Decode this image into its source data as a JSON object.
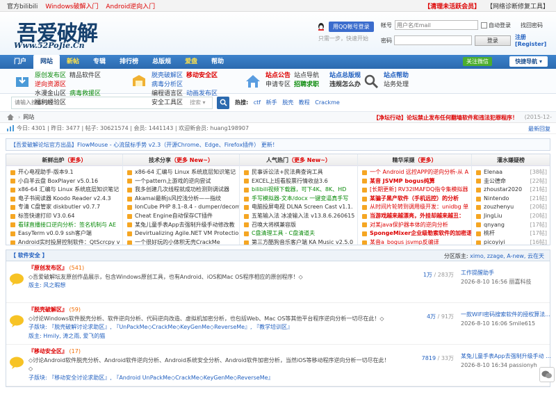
{
  "topbar": {
    "site_name": "官方bilibili",
    "link1": "Windows破解入门",
    "link2": "Android逆向入门",
    "right1": "【清理未活跃会员】",
    "right2": "【网络诊断修复工具】"
  },
  "header": {
    "logo_text": "吾爱破解",
    "logo_url": "Www.52PoJie.Cn",
    "qq_login": "用QQ帐号登录",
    "qq_tip": "只需一步，快速开始",
    "account_label": "帐号",
    "account_placeholder": "用户名/Email",
    "autologin": "自动登录",
    "find_pw": "找回密码",
    "password_label": "密码",
    "login_btn": "登录",
    "register": "注册[Register]"
  },
  "nav": {
    "items": [
      "门户",
      "网站",
      "新帖",
      "专辑",
      "排行榜",
      "总版规",
      "爱盘",
      "帮助"
    ],
    "wechat": "关注微信",
    "quick": "快捷导航 ▾"
  },
  "subnav": {
    "g1": [
      [
        "原创发布区",
        "精品软件区",
        "逆向资源区"
      ],
      [
        "水漫金山区",
        "病毒救援区",
        "福利经验区"
      ]
    ],
    "g2": [
      [
        "脱壳破解区",
        "移动安全区",
        "病毒分析区"
      ],
      [
        "编程语言区",
        "动画发布区",
        "安全工具区"
      ]
    ],
    "g3": [
      [
        "站点公告",
        "站点导航"
      ],
      [
        "申请专区",
        "招聘求职"
      ]
    ],
    "g4": [
      [
        "站点总版规"
      ],
      [
        "违规怎么办"
      ]
    ],
    "g5": [
      [
        "站点帮助"
      ],
      [
        "站务处理"
      ]
    ]
  },
  "search": {
    "placeholder": "请输入搜索内容",
    "select": "搜索 ▾",
    "hot_label": "热搜:",
    "hot": [
      "ctf",
      "新手",
      "脱壳",
      "教程",
      "Crackme"
    ]
  },
  "crumb": {
    "home": "网站",
    "notice": "【净坛行动】论坛禁止发布任何翻墙软件和违法犯罪程序！",
    "date": "(2015-12-"
  },
  "stats": {
    "text": "今日: 4301 | 昨日: 3477 | 帖子: 30621574 | 会员: 1441143 | 欢迎新会员: huang198907",
    "last": "最新回复"
  },
  "adline": {
    "text": "【吾爱破解论坛官方出品】FlowMouse - 心流鼠标手势 v2.3（开源Chrome、Edge、Firefox插件） 更新！"
  },
  "columns": [
    {
      "title": "新鲜出炉",
      "more": "（更多）",
      "items": [
        {
          "t": "开心电视助手-版本9.1"
        },
        {
          "t": "小白羊云盘 BoxPlayer v5.0.16"
        },
        {
          "t": "x86-64 汇编与 Linux 系统底层知识笔记"
        },
        {
          "t": "电子书阅读器 Koodo Reader v2.4.3"
        },
        {
          "t": "专清 C盘管家 diskbutler v0.7.7"
        },
        {
          "t": "标签快速打印 V3.0.64"
        },
        {
          "t": "看球直播接口逆向分析：签名机制与 AE"
        },
        {
          "t": "EasyTerm v0.0.9 ssh客户端"
        },
        {
          "t": "Android实时投屏控制软件：QtScrcpy v"
        },
        {
          "t": "传染病自动对码小工具2.0"
        }
      ]
    },
    {
      "title": "技术分享",
      "more": "（更多 New~）",
      "items": [
        {
          "t": "x86-64 汇编与 Linux 系统底层知识笔记"
        },
        {
          "t": "一个pattern上游戏的逆向尝试"
        },
        {
          "t": "我多创建几次线程就成功检测到调试器"
        },
        {
          "t": "Akamai最新js风控浅分析——指纹"
        },
        {
          "t": "IonCube PHP 8.1–8.4 - dumper/decomp"
        },
        {
          "t": "Cheat Engine自动保存CT插件"
        },
        {
          "t": "某兔儿童手表App去强制升级手动修改教"
        },
        {
          "t": "Devirtualizing Agile.NET VM Protection"
        },
        {
          "t": "一个很好玩的小体积无壳CrackMe"
        },
        {
          "t": "32位无壳带反调试模拟真实校验精品Cra"
        }
      ]
    },
    {
      "title": "人气热门",
      "more": "（更多 New~）",
      "items": [
        {
          "t": "民事诉讼法+民法典查询工具"
        },
        {
          "t": "EXCEL上班看股票行情收益3.6"
        },
        {
          "t": "bilibili视频下载器，可下4K、8K、HD"
        },
        {
          "t": "手写模拟器-文本/docx 一键变逼真手写"
        },
        {
          "t": "电脑投屏电视 DLNA Screen Cast v1.1."
        },
        {
          "t": "五笔输入法 冰凌输入法 v13.8.6.260615"
        },
        {
          "t": "召唤大将棋兼容版"
        },
        {
          "t": "C盘清理工具 - C盘清道夫"
        },
        {
          "t": "第三方酷狗音乐客户端 KA Music v2.5.0"
        },
        {
          "t": "随心听书 v2.0.13"
        }
      ]
    },
    {
      "title": "精华采撷",
      "more": "（更多）",
      "items": [
        {
          "t": "一个 Android 远控APP的逆向分析-从 A"
        },
        {
          "t": "某音 JSVMP bogus纯算"
        },
        {
          "t": "[长期更新] RV32IMAFDQ指令集模拟器"
        },
        {
          "t": "某骗子黑产软件（手机远控）的分析"
        },
        {
          "t": "从时间片轮转到调用级开发：unidbg 单"
        },
        {
          "t": "当游戏越来越漂亮，外挂却越来越丑："
        },
        {
          "t": "对某java保护器本体的逆向分析"
        },
        {
          "t": "SpongeMixer企业级勒索软件的加密逻"
        },
        {
          "t": "某音a_bogus jsvmp反编译"
        },
        {
          "t": "Q音VMP初始化分析&SHA-1算法识别"
        }
      ]
    },
    {
      "title": "灌水嫌疑榜",
      "more": "",
      "items": [
        {
          "t": "Elenaa",
          "c": "[38帖]"
        },
        {
          "t": "圭公德命",
          "c": "[22帖]"
        },
        {
          "t": "zhoustar2020",
          "c": "[21帖]"
        },
        {
          "t": "Nintendo",
          "c": "[21帖]"
        },
        {
          "t": "zouzhenyu",
          "c": "[20帖]"
        },
        {
          "t": "JingLiu",
          "c": "[20帖]"
        },
        {
          "t": "qnyang",
          "c": "[17帖]"
        },
        {
          "t": "桃杆",
          "c": "[17帖]"
        },
        {
          "t": "picoyiyi",
          "c": "[16帖]"
        },
        {
          "t": "xinchibaobei",
          "c": "[15帖]"
        }
      ]
    }
  ],
  "forum": {
    "section": "【 软件安全 】",
    "mods_label": "分区版主:",
    "mods": "ximo, zzage, A-new, 云在天",
    "rows": [
      {
        "title": "『原创发布区』",
        "today": "(541)",
        "desc": "◇吾爱破解坛友原创作品展示，包含Windows原创工具，也有Android、iOS和Mac OS程序相应的原创程序！◇",
        "mods": "版主: 风之暇想",
        "sub": "",
        "nums": "1万",
        "total": "/ 283万",
        "last_title": "工作提醒助手",
        "last_info": "2026-8-10 16:56 丽嘉科技"
      },
      {
        "title": "『脱壳破解区』",
        "today": "(59)",
        "desc": "◇讨论Windows软件脱壳分析、软件逆向分析、代码逆向改造、虚拟机加密分析，也包括Web、Mac OS等其他平台程序逆向分析一切尽在此！◇",
        "sub": "子版块: 『脱壳破解讨论求助区』, 『UnPackMe◇CrackMe◇KeyGenMe◇ReverseMe』, 『教学培训区』",
        "mods": "版主: Hmily, 涛之雨, 爱飞的猫",
        "nums": "4万",
        "total": "/ 91万",
        "last_title": "一款WIFI密码搜索软件的授权算法...",
        "last_info": "2026-8-10 16:06 Smile615"
      },
      {
        "title": "『移动安全区』",
        "today": "(17)",
        "desc": "◇讨论Android软件脱壳分析、Android软件逆向分析、Android系统安全分析、Android软件加密分析，当然iOS等移动程序逆向分析一切尽在此！◇",
        "sub": "子版块: 『移动安全讨论求助区』, 『Android UnPackMe◇CrackMe◇KeyGenMe◇ReverseMe』",
        "mods": "",
        "nums": "7819",
        "total": "/ 33万",
        "last_title": "某兔儿童手表App去强制升级手动 ...",
        "last_info": "2026-8-10 16:34 passionyh"
      }
    ]
  }
}
